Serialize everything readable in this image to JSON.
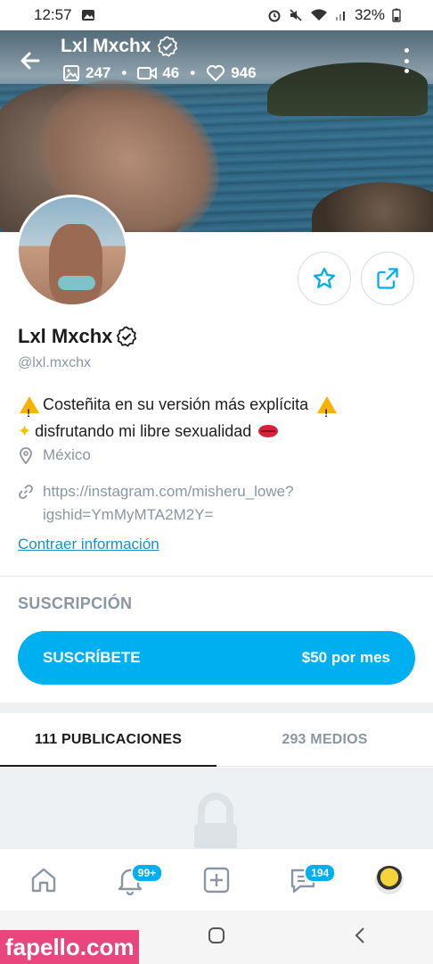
{
  "status_bar": {
    "time": "12:57",
    "battery": "32%"
  },
  "header": {
    "name": "Lxl Mxchx",
    "stats": {
      "photos": "247",
      "videos": "46",
      "likes": "946"
    }
  },
  "profile": {
    "name": "Lxl Mxchx",
    "handle": "@lxl.mxchx",
    "bio_line1": "Costeñita en su versión más explícita",
    "bio_line2": "disfrutando mi libre sexualidad",
    "location": "México",
    "link_line1": "https://instagram.com/misheru_lowe?",
    "link_line2": "igshid=YmMyMTA2M2Y=",
    "collapse_label": "Contraer información"
  },
  "subscription": {
    "title": "SUSCRIPCIÓN",
    "button_label": "SUSCRÍBETE",
    "price": "$50 por mes"
  },
  "tabs": [
    {
      "label": "111 PUBLICACIONES",
      "active": true
    },
    {
      "label": "293 MEDIOS",
      "active": false
    }
  ],
  "bottom_nav": {
    "notifications_badge": "99+",
    "messages_badge": "194"
  },
  "watermark": "fapello.com",
  "colors": {
    "accent": "#00aff0",
    "muted": "#8a96a3",
    "link": "#1a8fc6"
  },
  "icons": [
    "back-arrow-icon",
    "verified-icon",
    "photo-icon",
    "video-icon",
    "heart-icon",
    "more-vertical-icon",
    "star-icon",
    "share-icon",
    "location-pin-icon",
    "link-icon",
    "lock-icon",
    "home-icon",
    "bell-icon",
    "plus-square-icon",
    "message-icon"
  ]
}
